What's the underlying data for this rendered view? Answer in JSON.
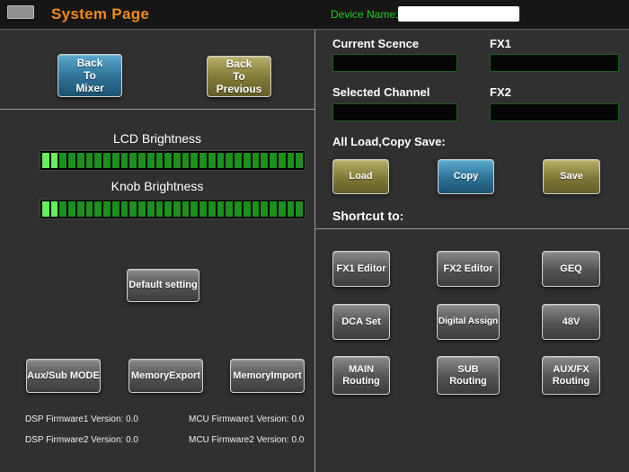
{
  "header": {
    "title": "System Page",
    "device_name_label": "Device Name:",
    "device_name_value": ""
  },
  "left": {
    "back_mixer": "Back\nTo\nMixer",
    "back_previous": "Back\nTo\nPrevious",
    "lcd_label": "LCD Brightness",
    "knob_label": "Knob Brightness",
    "lcd_meter": {
      "segments": 30,
      "lit": 2
    },
    "knob_meter": {
      "segments": 30,
      "lit": 2
    },
    "default_setting": "Default setting",
    "aux_sub_mode": "Aux/Sub MODE",
    "memory_export": "MemoryExport",
    "memory_import": "MemoryImport",
    "firmware": {
      "dsp1": "DSP Firmware1 Version: 0.0",
      "dsp2": "DSP Firmware2 Version: 0.0",
      "mcu1": "MCU Firmware1 Version: 0.0",
      "mcu2": "MCU Firmware2 Version: 0.0"
    }
  },
  "right": {
    "current_scene_label": "Current Scence",
    "fx1_label": "FX1",
    "selected_channel_label": "Selected Channel",
    "fx2_label": "FX2",
    "current_scene_value": "",
    "fx1_value": "",
    "selected_channel_value": "",
    "fx2_value": "",
    "all_load_copy_save_label": "All Load,Copy Save:",
    "load": "Load",
    "copy": "Copy",
    "save": "Save",
    "shortcut_label": "Shortcut to:",
    "shortcuts": [
      "FX1 Editor",
      "FX2 Editor",
      "GEQ",
      "DCA Set",
      "Digital Assign",
      "48V",
      "MAIN\nRouting",
      "SUB\nRouting",
      "AUX/FX\nRouting"
    ]
  },
  "colors": {
    "accent_orange": "#ED8B16",
    "accent_green": "#21cc21",
    "button_blue": "#2d7096",
    "button_olive": "#7e7838",
    "meter_lit": "#64f05a",
    "meter_unlit": "#1c8f1c"
  }
}
